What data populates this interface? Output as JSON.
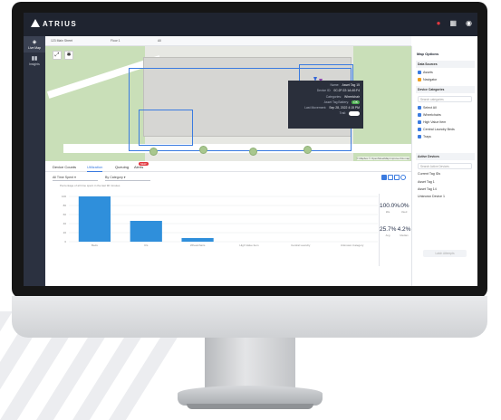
{
  "app": {
    "brand": "ATRIUS"
  },
  "topbar": {
    "icons": [
      "notification-icon",
      "dashboard-icon",
      "user-icon"
    ],
    "accent": "#e2383f"
  },
  "leftnav": {
    "items": [
      {
        "label": "Live Map",
        "icon": "map-icon"
      },
      {
        "label": "Insights",
        "icon": "insights-icon"
      }
    ]
  },
  "filters": {
    "site": "123 Main Street",
    "building": "Floor 1",
    "level": "All"
  },
  "map": {
    "controls": [
      "expand-icon",
      "settings-icon"
    ],
    "popup": {
      "rows": [
        {
          "k": "Name:",
          "v": "Asset Tag 15"
        },
        {
          "k": "Device ID:",
          "v": "0C:2F:22:1A:40:F4"
        },
        {
          "k": "Categories:",
          "v": "Wheelchair"
        },
        {
          "k": "Asset Tag Battery:",
          "v": "OK"
        },
        {
          "k": "Last Movement:",
          "v": "Sep 28, 2022 4:15 PM"
        },
        {
          "k": "Trail:",
          "v": ""
        }
      ]
    },
    "attribution": "© Mapbox © OpenStreetMap Improve this map"
  },
  "tabs": [
    {
      "label": "Device Counts"
    },
    {
      "label": "Utilization"
    },
    {
      "label": "Queuing"
    },
    {
      "label": "Alerts",
      "badge": "NEW"
    }
  ],
  "chart_controls": {
    "time": "All Time Spent",
    "group": "By Category",
    "note": "Percentage of all time spent in the last 90 minutes"
  },
  "chart_data": {
    "type": "bar",
    "categories": [
      "Beds",
      "IVs",
      "Wheelchairs",
      "High Value Item",
      "Central Laundry",
      "Unknown Category"
    ],
    "values": [
      100,
      46,
      8,
      0,
      0,
      0
    ],
    "ylim": [
      0,
      100
    ],
    "yticks": [
      "100",
      "80",
      "60",
      "40",
      "20",
      "0"
    ],
    "color": "#2f8fdb"
  },
  "stats": [
    {
      "value": "100.0%",
      "label": "Idle"
    },
    {
      "value": ".0%",
      "label": "Used"
    },
    {
      "value": "25.7%",
      "label": "Avg"
    },
    {
      "value": "4.2%",
      "label": "Median"
    }
  ],
  "right_panel": {
    "title": "Map Options",
    "data_sources_label": "Data Sources",
    "sources": [
      {
        "label": "Assets"
      },
      {
        "label": "Navigator"
      }
    ],
    "categories_label": "Device Categories",
    "categories_search": "Search categories",
    "categories": [
      {
        "label": "Select All"
      },
      {
        "label": "Wheelchairs"
      },
      {
        "label": "High Value Item"
      },
      {
        "label": "Central Laundry Beds"
      },
      {
        "label": "Trays"
      }
    ],
    "active_label": "Active Devices",
    "active_search": "Search Active Devices",
    "devices": [
      {
        "label": "Current Tag IDs"
      },
      {
        "label": "Asset Tag 1"
      },
      {
        "label": "Asset Tag 14"
      },
      {
        "label": "Unknown Device 1"
      }
    ],
    "action_button": "Latch Attempts"
  }
}
